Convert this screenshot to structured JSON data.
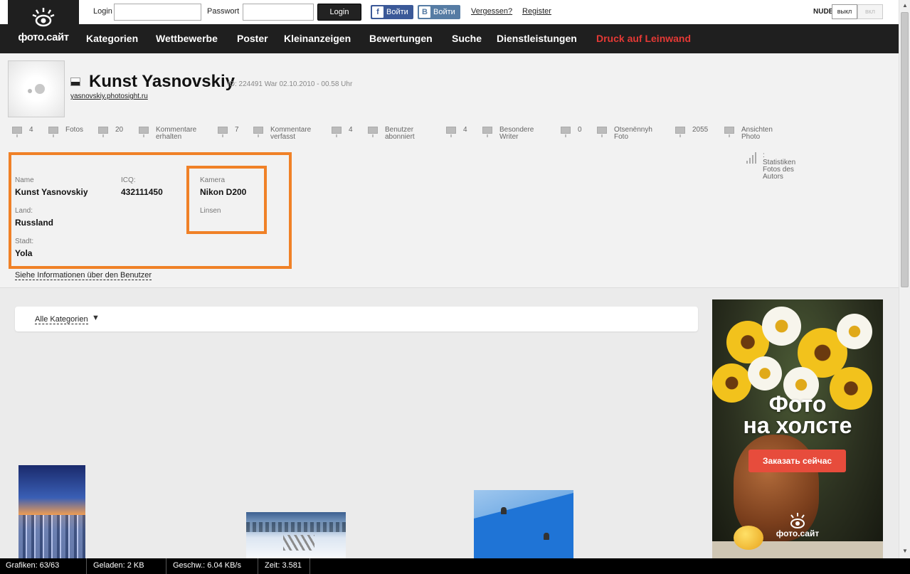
{
  "logo": {
    "brand": "фото.сайт"
  },
  "login": {
    "login_label": "Login",
    "password_label": "Passwort",
    "login_value": "",
    "password_value": "",
    "login_button": "Login",
    "fb_label": "Войти",
    "fb_icon": "f",
    "vk_label": "Войти",
    "vk_icon": "B",
    "forgot": "Vergessen?",
    "register": "Register"
  },
  "nude": {
    "label": "NUDE",
    "off": "выкл",
    "on": "вкл"
  },
  "nav": {
    "items": [
      "Kategorien",
      "Wettbewerbe",
      "Poster",
      "Kleinanzeigen",
      "Bewertungen",
      "Suche",
      "Dienstleistungen"
    ],
    "highlight": "Druck auf Leinwand",
    "highlight_color": "#e53935"
  },
  "profile": {
    "name": "Kunst Yasnovskiy",
    "meta": "ID: 224491 War 02.10.2010 - 00.58 Uhr",
    "url": "yasnovskiy.photosight.ru"
  },
  "stats": [
    {
      "value": "4",
      "label1": "Fotos",
      "label2": ""
    },
    {
      "value": "20",
      "label1": "Kommentare",
      "label2": "erhalten"
    },
    {
      "value": "7",
      "label1": "Kommentare",
      "label2": "verfasst"
    },
    {
      "value": "4",
      "label1": "Benutzer",
      "label2": "abonniert"
    },
    {
      "value": "4",
      "label1": "Besondere",
      "label2": "Writer"
    },
    {
      "value": "0",
      "label1": "Otsenënnyh",
      "label2": "Foto"
    },
    {
      "value": "2055",
      "label1": "Ansichten",
      "label2": "Photo"
    }
  ],
  "info": {
    "name_label": "Name",
    "name_value": "Kunst Yasnovskiy",
    "icq_label": "ICQ:",
    "icq_value": "432111450",
    "country_label": "Land:",
    "country_value": "Russland",
    "city_label": "Stadt:",
    "city_value": "Yola",
    "camera_label": "Kamera",
    "camera_value": "Nikon D200",
    "lens_label": "Linsen",
    "more_link": "Siehe Informationen über den Benutzer",
    "highlight_color": "#f08127"
  },
  "author_stats": {
    "line0": ":",
    "line1": "Statistiken",
    "line2": "Fotos des",
    "line3": "Autors"
  },
  "category_filter": {
    "label": "Alle Kategorien",
    "arrow": "▼"
  },
  "ad": {
    "title_line1": "Фото",
    "title_line2": "на холсте",
    "button": "Заказать сейчас",
    "logo": "фото.сайт"
  },
  "statusbar": {
    "grafiken": "Grafiken: 63/63",
    "geladen": "Geladen: 2 KB",
    "geschw": "Geschw.: 6.04 KB/s",
    "zeit": "Zeit: 3.581"
  }
}
